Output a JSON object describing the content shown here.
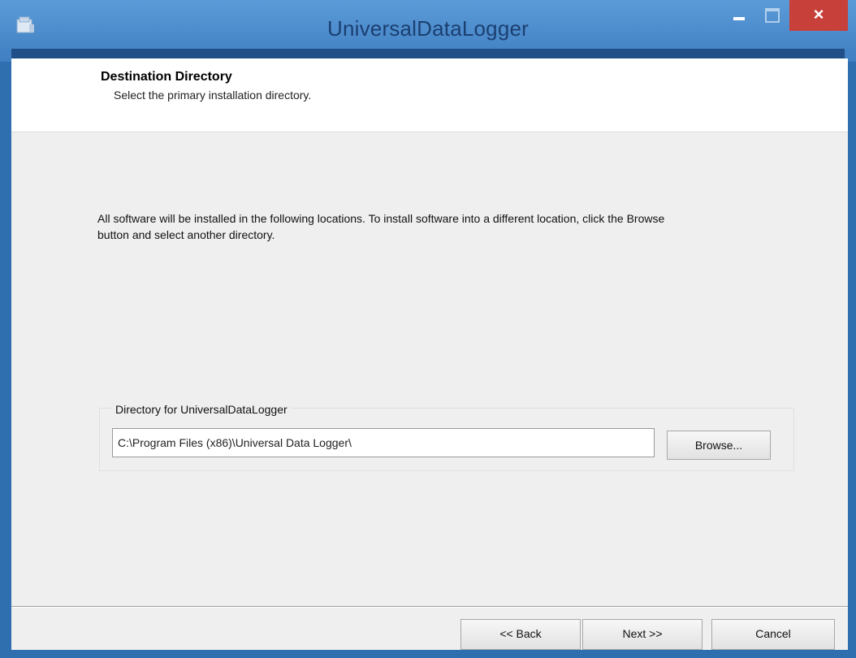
{
  "window": {
    "title": "UniversalDataLogger",
    "close_glyph": "×"
  },
  "header": {
    "title": "Destination Directory",
    "subtitle": "Select the primary installation directory."
  },
  "main": {
    "description": "All software will be installed in the following locations. To install software into a different location, click the Browse button and select another directory."
  },
  "directory": {
    "group_label": "Directory for UniversalDataLogger",
    "path_value": "C:\\Program Files (x86)\\Universal Data Logger\\",
    "browse_label": "Browse..."
  },
  "footer": {
    "back_label": "<< Back",
    "next_label": "Next >>",
    "cancel_label": "Cancel"
  },
  "colors": {
    "titlebar": "#4a8ccd",
    "close_button": "#c7403a",
    "client_background": "#efefef"
  },
  "icons": {
    "app": "installer-app-icon",
    "minimize": "minimize-icon",
    "maximize": "maximize-icon",
    "close": "close-icon"
  }
}
